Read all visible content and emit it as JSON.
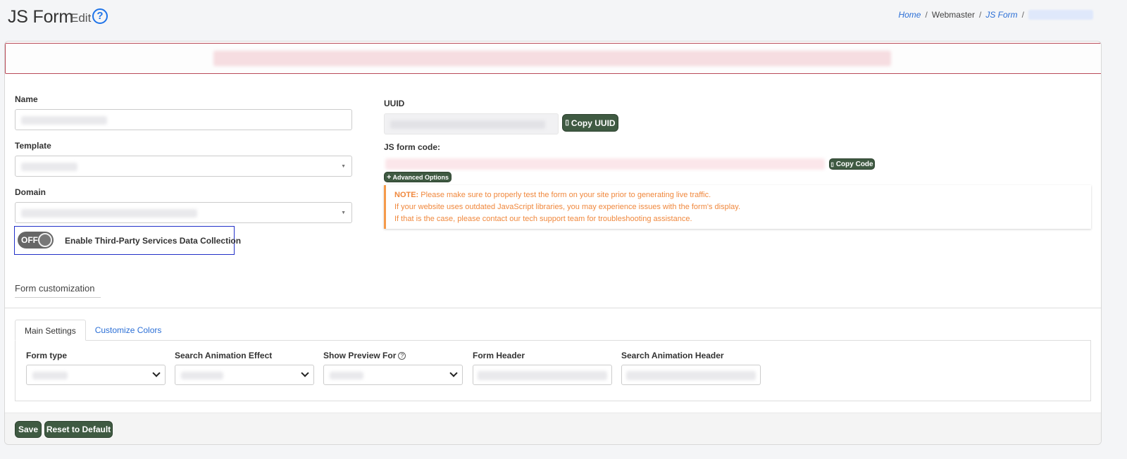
{
  "header": {
    "title": "JS Form",
    "subtitle": "Edit",
    "help_glyph": "?",
    "breadcrumb": {
      "home": "Home",
      "webmaster": "Webmaster",
      "js_form": "JS Form",
      "sep": "/"
    }
  },
  "form": {
    "name_label": "Name",
    "template_label": "Template",
    "domain_label": "Domain",
    "toggle_state": "OFF",
    "toggle_label": "Enable Third-Party Services Data Collection"
  },
  "uuid": {
    "label": "UUID",
    "copy_button": "Copy UUID",
    "code_label": "JS form code:",
    "copy_code_button": "Copy Code",
    "advanced_button": "Advanced Options"
  },
  "note": {
    "prefix": "NOTE:",
    "line1": "Please make sure to properly test the form on your site prior to generating live traffic.",
    "line2": "If your website uses outdated JavaScript libraries, you may experience issues with the form's display.",
    "line3": "If that is the case, please contact our tech support team for troubleshooting assistance."
  },
  "customization": {
    "title": "Form customization",
    "tabs": [
      {
        "label": "Main Settings",
        "active": true
      },
      {
        "label": "Customize Colors",
        "active": false
      }
    ],
    "fields": {
      "form_type": "Form type",
      "search_animation_effect": "Search Animation Effect",
      "show_preview_for": "Show Preview For",
      "form_header": "Form Header",
      "search_animation_header": "Search Animation Header"
    }
  },
  "footer": {
    "save": "Save",
    "reset": "Reset to Default"
  },
  "colors": {
    "accent": "#3f5a42",
    "link": "#2b6fd6",
    "alert_border": "#b94a58",
    "note_text": "#f0883d",
    "toggle_highlight": "#2230c8"
  },
  "icons": {
    "help": "question-circle-icon",
    "copy": "clipboard-icon",
    "plus": "plus-icon",
    "select": "chevron-down-icon"
  }
}
